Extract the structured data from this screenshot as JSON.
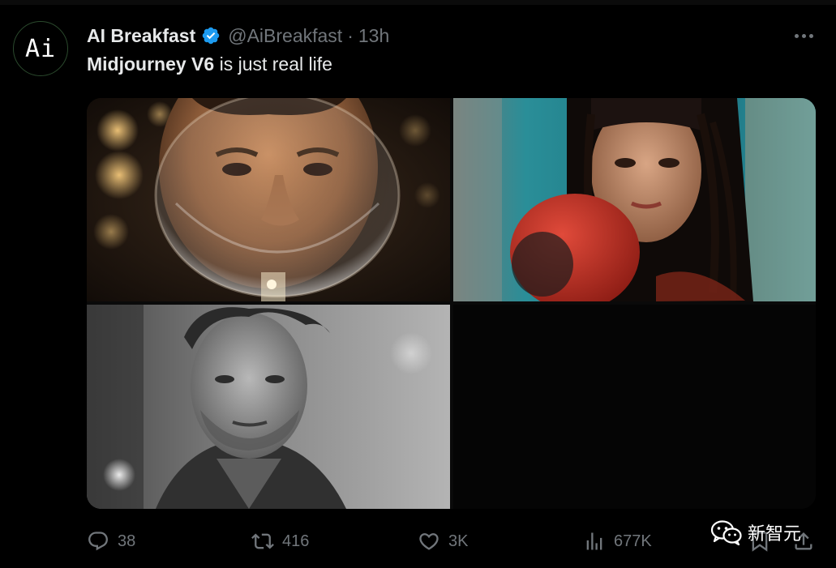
{
  "author": {
    "display_name": "AI Breakfast",
    "avatar_text": "Ai",
    "handle": "@AiBreakfast",
    "separator": "·",
    "time": "13h"
  },
  "tweet": {
    "text_bold": "Midjourney V6",
    "text_rest": " is just real life"
  },
  "media": {
    "photos": [
      {
        "icon": "photo-man-wine-glass"
      },
      {
        "icon": "photo-woman-boxing-glove"
      },
      {
        "icon": "photo-man-black-white-portrait"
      }
    ]
  },
  "actions": {
    "reply_count": "38",
    "retweet_count": "416",
    "like_count": "3K",
    "view_count": "677K"
  },
  "watermark": {
    "text": "新智元"
  },
  "colors": {
    "background": "#000000",
    "primary_text": "#e7e9ea",
    "secondary_text": "#71767b",
    "verified_blue": "#1d9bf0"
  }
}
